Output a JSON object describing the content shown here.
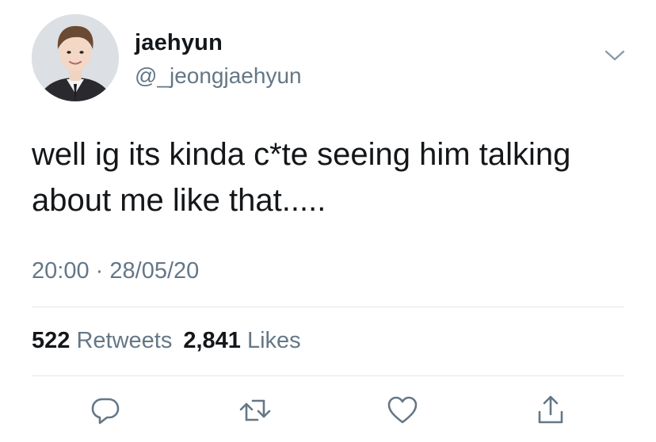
{
  "user": {
    "display_name": "jaehyun",
    "handle": "@_jeongjaehyun",
    "avatar": "profile-photo"
  },
  "tweet": {
    "text": "well ig its kinda c*te seeing him talking\nabout me like that.....",
    "time": "20:00",
    "separator": "·",
    "date": "28/05/20"
  },
  "stats": {
    "retweets_count": "522",
    "retweets_label": "Retweets",
    "likes_count": "2,841",
    "likes_label": "Likes"
  },
  "icons": {
    "menu": "chevron-down-icon",
    "reply": "reply-icon",
    "retweet": "retweet-icon",
    "like": "heart-icon",
    "share": "share-icon"
  },
  "colors": {
    "text": "#14171a",
    "secondary": "#657786",
    "divider": "#e1e8ed",
    "icon": "#657786"
  }
}
